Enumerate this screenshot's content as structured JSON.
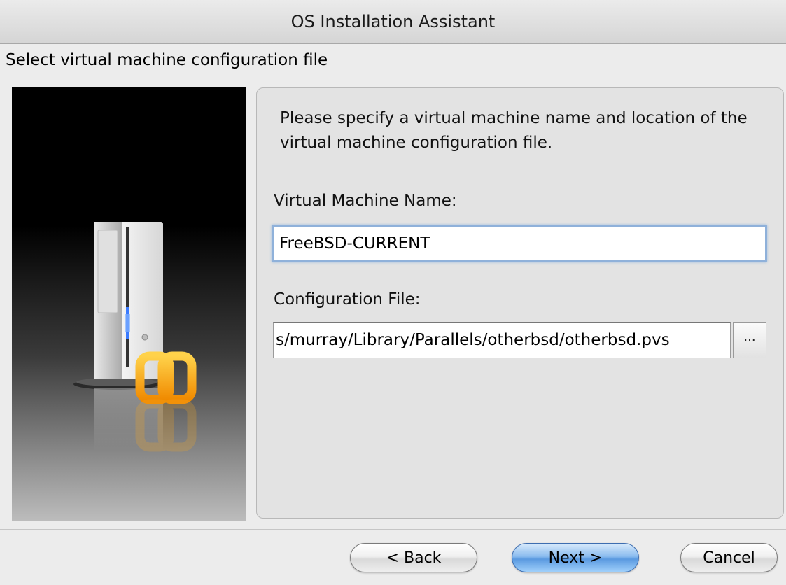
{
  "window": {
    "title": "OS Installation Assistant"
  },
  "step": {
    "title": "Select virtual machine configuration file"
  },
  "content": {
    "intro": "Please specify a virtual machine name and location of the virtual machine configuration file.",
    "vm_name_label": "Virtual Machine Name:",
    "vm_name_value": "FreeBSD-CURRENT",
    "config_file_label": "Configuration File:",
    "config_file_value": "s/murray/Library/Parallels/otherbsd/otherbsd.pvs",
    "browse_label": "···"
  },
  "buttons": {
    "back": "< Back",
    "next": "Next >",
    "cancel": "Cancel"
  },
  "icons": {
    "side_image": "server-tower-with-parallels-logo"
  },
  "colors": {
    "next_button": "#6aa6e6",
    "focus_ring": "#8fb1da",
    "logo_orange": "#f5a623"
  }
}
